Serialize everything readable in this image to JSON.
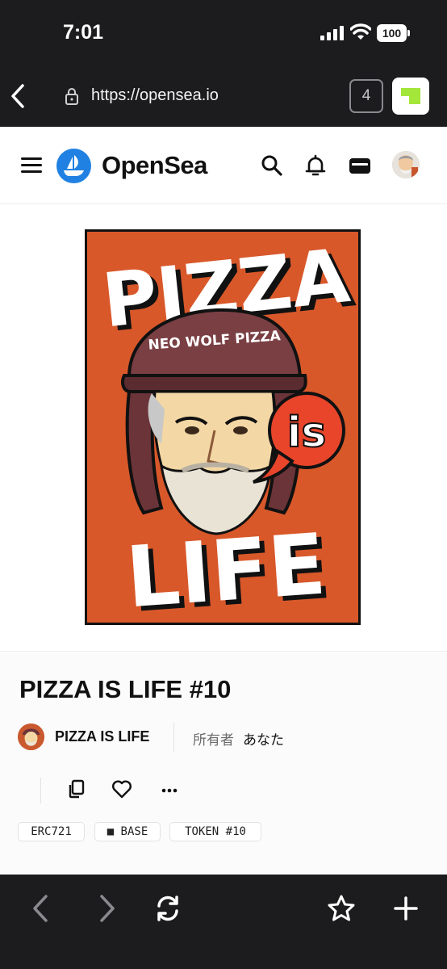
{
  "status_bar": {
    "time": "7:01",
    "battery": "100"
  },
  "browser": {
    "url": "https://opensea.io",
    "tab_count": "4"
  },
  "site_header": {
    "brand": "OpenSea"
  },
  "artwork": {
    "headline_top": "PIZZA",
    "helmet_text": "NEO WOLF PIZZA",
    "bubble_text": "is",
    "headline_bottom": "LIFE"
  },
  "nft": {
    "title": "PIZZA IS LIFE #10",
    "collection": "PIZZA IS LIFE",
    "owner_label": "所有者",
    "owner_value": "あなた",
    "chips": [
      "ERC721",
      "■ BASE",
      "TOKEN #10"
    ]
  },
  "icons": [
    "back-chevron-icon",
    "lock-icon",
    "menu-icon",
    "search-icon",
    "bell-icon",
    "wallet-icon",
    "copy-icon",
    "heart-icon",
    "more-icon",
    "refresh-icon",
    "star-icon",
    "plus-icon"
  ],
  "colors": {
    "opensea_blue": "#2081e2",
    "poster_orange": "#d8582a",
    "browser_dark": "#1c1c1e"
  }
}
